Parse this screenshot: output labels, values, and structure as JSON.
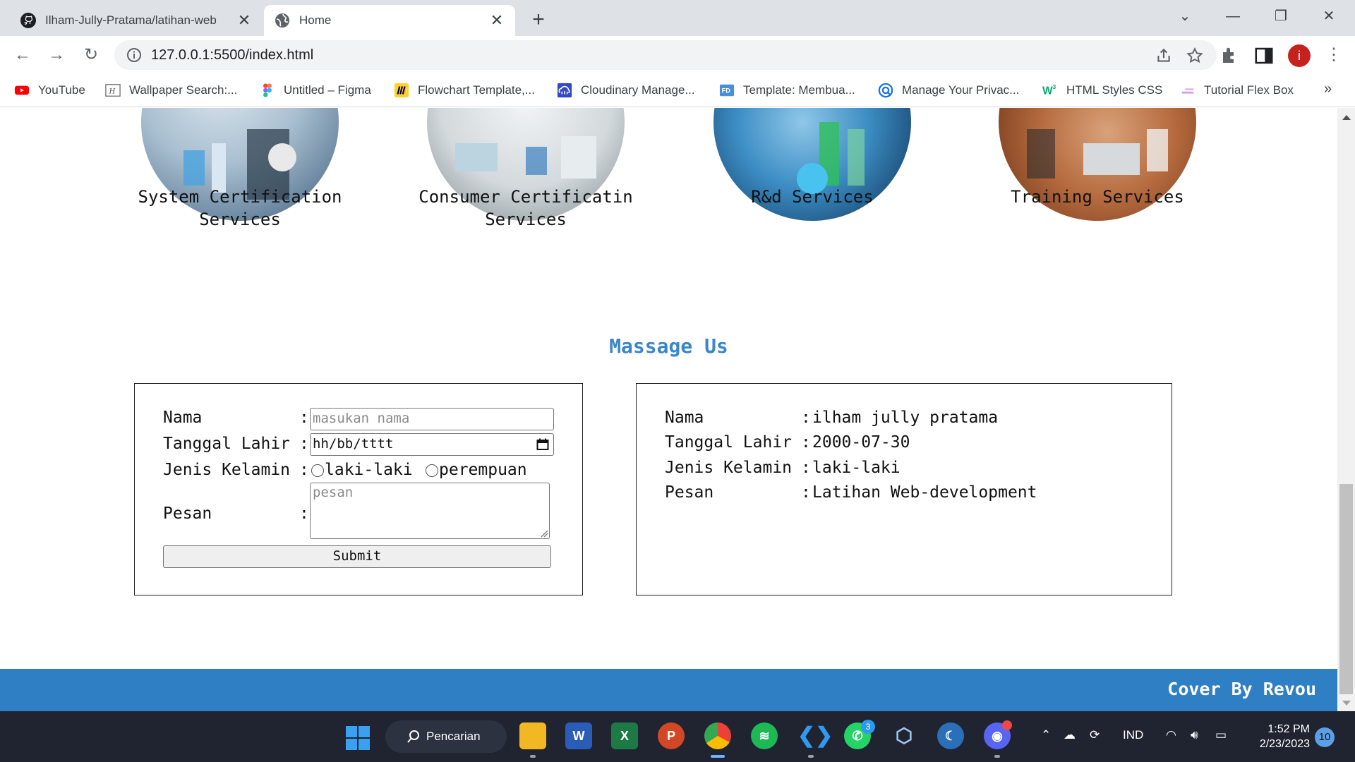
{
  "browser": {
    "tabs": [
      {
        "title": "Ilham-Jully-Pratama/latihan-web"
      },
      {
        "title": "Home"
      }
    ],
    "url": "127.0.0.1:5500/index.html",
    "avatar_letter": "i",
    "bookmarks": [
      {
        "label": "YouTube",
        "icon": "youtube-icon"
      },
      {
        "label": "Wallpaper Search:...",
        "icon": "wallpaper-icon"
      },
      {
        "label": "Untitled – Figma",
        "icon": "figma-icon"
      },
      {
        "label": "Flowchart Template,...",
        "icon": "miro-icon"
      },
      {
        "label": "Cloudinary Manage...",
        "icon": "cloudinary-icon"
      },
      {
        "label": "Template: Membua...",
        "icon": "template-icon"
      },
      {
        "label": "Manage Your Privac...",
        "icon": "privacy-icon"
      },
      {
        "label": "HTML Styles CSS",
        "icon": "w3schools-icon"
      },
      {
        "label": "Tutorial Flex Box",
        "icon": "flexbox-icon"
      }
    ],
    "bookmarks_more": "»"
  },
  "page": {
    "services": [
      {
        "caption": "System Certification Services"
      },
      {
        "caption": "Consumer Certificatin Services"
      },
      {
        "caption": "R&d Services"
      },
      {
        "caption": "Training Services"
      }
    ],
    "section_title": "Massage Us",
    "form": {
      "nama_label": "Nama",
      "nama_placeholder": "masukan nama",
      "tanggal_label": "Tanggal Lahir",
      "tanggal_placeholder": "hh/bb/tttt",
      "jenis_label": "Jenis Kelamin",
      "option_male": "laki-laki",
      "option_female": "perempuan",
      "pesan_label": "Pesan",
      "pesan_placeholder": "pesan",
      "colon": ":",
      "submit_label": "Submit"
    },
    "result": {
      "nama_label": "Nama",
      "nama_value": "ilham jully pratama",
      "tanggal_label": "Tanggal Lahir",
      "tanggal_value": "2000-07-30",
      "jenis_label": "Jenis Kelamin",
      "jenis_value": "laki-laki",
      "pesan_label": "Pesan",
      "pesan_value": "Latihan Web-development",
      "colon": ":"
    },
    "footer_credit": "Cover By Revou"
  },
  "taskbar": {
    "search_label": "Pencarian",
    "whatsapp_badge": "3",
    "language": "IND",
    "time": "1:52 PM",
    "date": "2/23/2023",
    "notifications": "10"
  },
  "colors": {
    "accent": "#3a86c8",
    "footer": "#2f7fc4",
    "taskbar": "#1f2430"
  }
}
